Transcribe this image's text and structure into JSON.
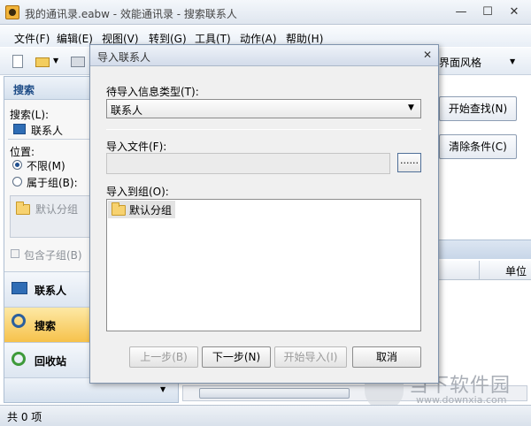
{
  "window": {
    "title": "我的通讯录.eabw - 效能通讯录 - 搜索联系人",
    "minimize": "—",
    "maximize": "☐",
    "close": "✕"
  },
  "menu": [
    "文件(F)",
    "编辑(E)",
    "视图(V)",
    "转到(G)",
    "工具(T)",
    "动作(A)",
    "帮助(H)"
  ],
  "toolbar": {
    "style_label": "界面风格",
    "style_arrow": "▼"
  },
  "left_panel": {
    "header": "搜索",
    "search_label": "搜索(L):",
    "search_target": "联系人",
    "position_label": "位置:",
    "radio_unlimited": "不限(M)",
    "radio_group": "属于组(B):",
    "group_item": "默认分组",
    "include_subgroups": "包含子组(B)",
    "nav": [
      "联系人",
      "搜索",
      "回收站"
    ]
  },
  "main": {
    "start_search_button": "开始查找(N)",
    "clear_button": "清除条件(C)",
    "col_unit": "单位"
  },
  "status": {
    "count": "共 0 项"
  },
  "dialog": {
    "title": "导入联系人",
    "close": "✕",
    "type_label": "待导入信息类型(T):",
    "type_value": "联系人",
    "file_label": "导入文件(F):",
    "file_value": "",
    "browse_label": "......",
    "group_label": "导入到组(O):",
    "group_item": "默认分组",
    "buttons": {
      "prev": "上一步(B)",
      "next": "下一步(N)",
      "start": "开始导入(I)",
      "cancel": "取消"
    }
  },
  "watermark": {
    "brand": "当下软件园",
    "url": "www.downxia.com"
  }
}
